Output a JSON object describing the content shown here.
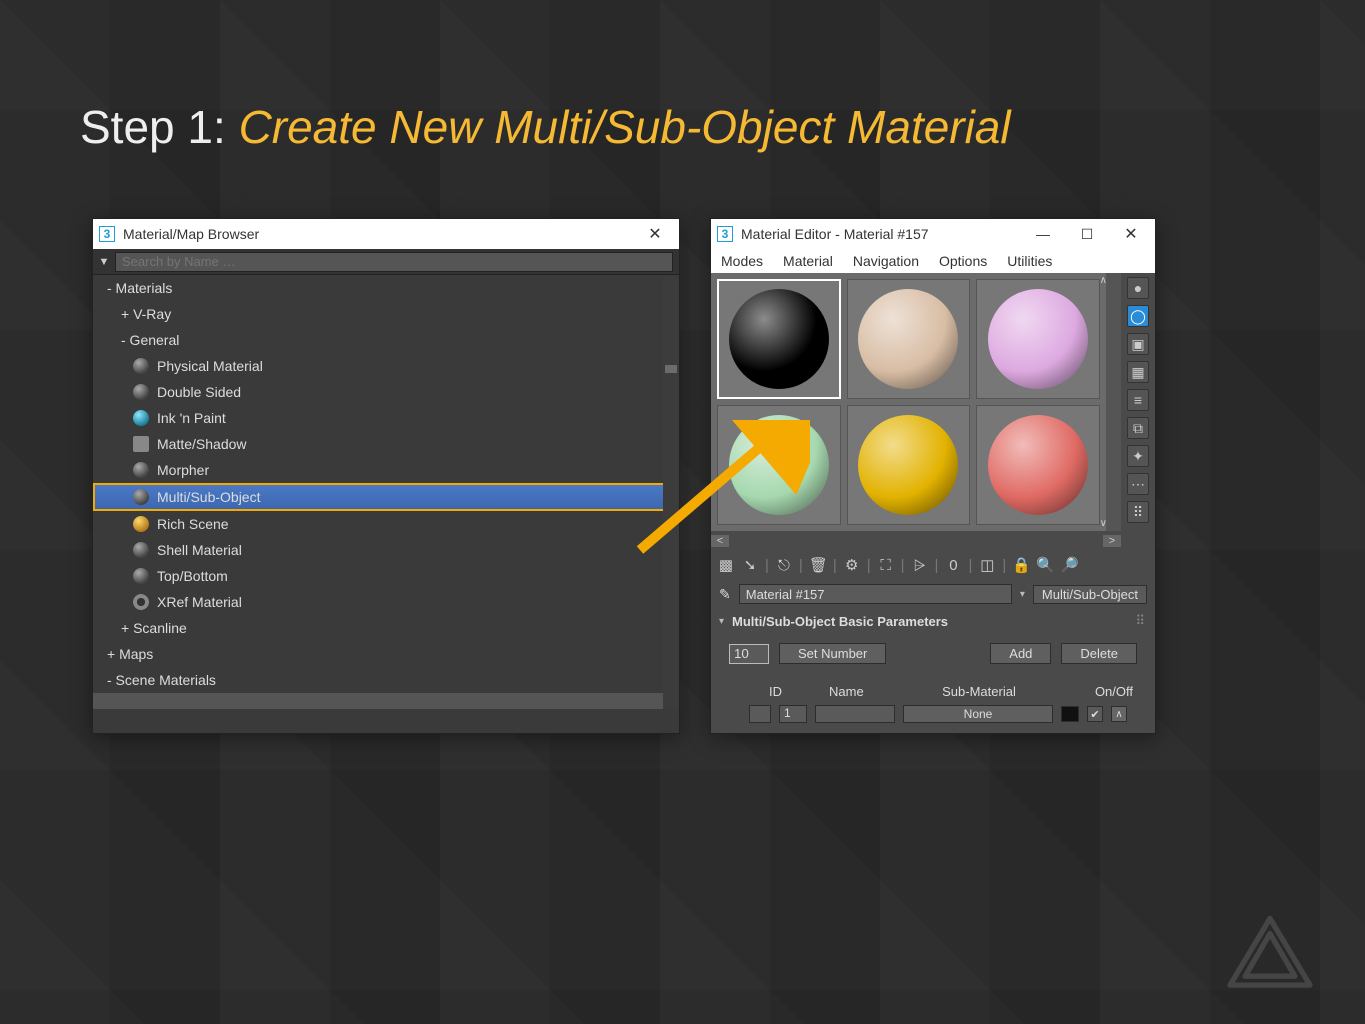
{
  "slide": {
    "step_label": "Step 1: ",
    "title": "Create New Multi/Sub-Object Material"
  },
  "browser": {
    "window_title": "Material/Map Browser",
    "close_glyph": "✕",
    "search_placeholder": "Search by Name …",
    "groups": {
      "materials": "- Materials",
      "vray": "+ V-Ray",
      "general": "- General",
      "scanline": "+ Scanline",
      "maps": "+ Maps",
      "scene": "- Scene Materials"
    },
    "general_items": [
      "Physical Material",
      "Double Sided",
      "Ink 'n Paint",
      "Matte/Shadow",
      "Morpher",
      "Multi/Sub-Object",
      "Rich Scene",
      "Shell Material",
      "Top/Bottom",
      "XRef Material"
    ],
    "selected_index": 5
  },
  "editor": {
    "window_title": "Material Editor - Material #157",
    "minimize_glyph": "—",
    "maximize_glyph": "☐",
    "close_glyph": "✕",
    "menus": [
      "Modes",
      "Material",
      "Navigation",
      "Options",
      "Utilities"
    ],
    "samples": [
      {
        "name": "slot-1",
        "color": "#000000",
        "selected": true
      },
      {
        "name": "slot-2",
        "color": "#d8bda4",
        "selected": false
      },
      {
        "name": "slot-3",
        "color": "#dda9e0",
        "selected": false
      },
      {
        "name": "slot-4",
        "color": "#a6d8ae",
        "selected": false
      },
      {
        "name": "slot-5",
        "color": "#e2b200",
        "selected": false
      },
      {
        "name": "slot-6",
        "color": "#e06a64",
        "selected": false
      }
    ],
    "scroll": {
      "left": "<",
      "right": ">",
      "up": "∧",
      "down": "∨"
    },
    "side_tools": [
      "●",
      "◯",
      "▣",
      "▦",
      "≡",
      "⧉",
      "✦",
      "⋯",
      "⠿"
    ],
    "toolbar_icons": [
      "▩",
      "➘",
      "|",
      "⎋",
      "|",
      "🗑",
      "|",
      "⚙",
      "|",
      "⛶",
      "|",
      "⩥",
      "|",
      "0",
      "|",
      "◫",
      "|",
      "🔒",
      "🔍",
      "🔎"
    ],
    "pencil_glyph": "✎",
    "material_name": "Material #157",
    "type_dropdown_glyph": "▾",
    "material_type": "Multi/Sub-Object",
    "rollout_caret": "▾",
    "rollout_title": "Multi/Sub-Object Basic Parameters",
    "rollout_grip": "⠿",
    "set_number_value": "10",
    "set_number_label": "Set Number",
    "add_label": "Add",
    "delete_label": "Delete",
    "table_headers": {
      "id": "ID",
      "name": "Name",
      "sub": "Sub-Material",
      "onoff": "On/Off"
    },
    "row1": {
      "id": "1",
      "sub_label": "None",
      "check_glyph": "✔",
      "scroll_glyph": "∧"
    }
  }
}
